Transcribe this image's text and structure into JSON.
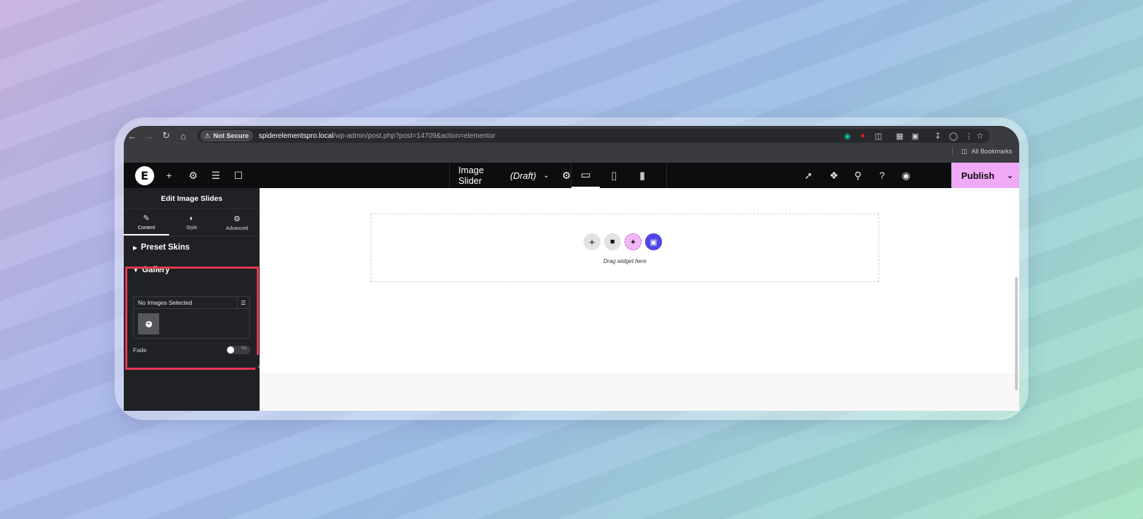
{
  "browser": {
    "security_label": "Not Secure",
    "url_host": "spiderelementspro.local",
    "url_path": "/wp-admin/post.php?post=14709&action=elementor",
    "bookmarks_label": "All Bookmarks"
  },
  "topbar": {
    "doc_title": "Image Slider",
    "doc_status": "(Draft)",
    "publish_label": "Publish"
  },
  "panel": {
    "title": "Edit Image Slides",
    "tabs": [
      {
        "label": "Content",
        "icon": "pencil-icon"
      },
      {
        "label": "Style",
        "icon": "contrast-icon"
      },
      {
        "label": "Advanced",
        "icon": "gear-icon"
      }
    ],
    "sections": {
      "preset_skins": "Preset Skins",
      "gallery": "Gallery"
    },
    "gallery": {
      "status": "No Images Selected"
    },
    "fade": {
      "label": "Fade",
      "toggle_text": "No",
      "value": false
    }
  },
  "canvas": {
    "drop_text": "Drag widget here"
  },
  "colors": {
    "publish_bg": "#f0a9f7",
    "highlight_border": "#e8384f",
    "spider_button": "#4f46e5"
  }
}
